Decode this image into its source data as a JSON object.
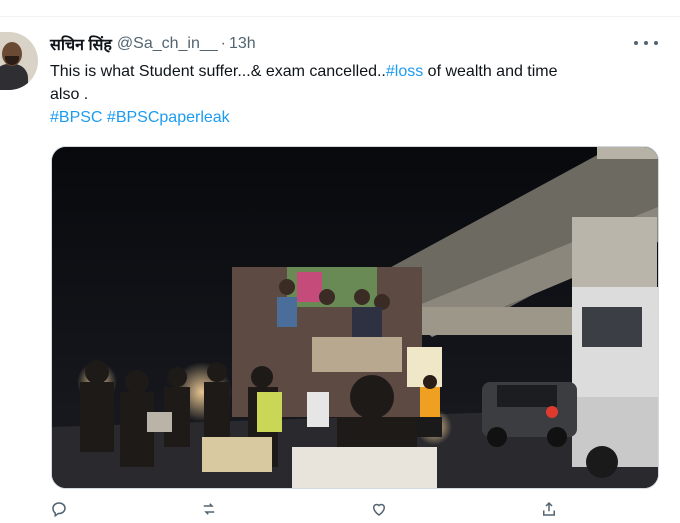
{
  "tweet": {
    "author_name": "सचिन सिंह",
    "handle": "@Sa_ch_in__",
    "separator": "·",
    "time": "13h",
    "text_line1_prefix": "This is what Student suffer...& exam cancelled..",
    "text_line1_hashtag": "#loss",
    "text_line1_suffix": " of wealth and time",
    "text_line2": "also .",
    "hashtags": [
      "#BPSC",
      "#BPSCpaperleak"
    ]
  },
  "icons": {
    "more": "more-horizontal-icon",
    "reply": "reply-icon",
    "retweet": "retweet-icon",
    "like": "like-icon",
    "share": "share-icon"
  },
  "colors": {
    "link": "#1d9bf0",
    "text": "#0f1419",
    "secondary": "#536471"
  }
}
